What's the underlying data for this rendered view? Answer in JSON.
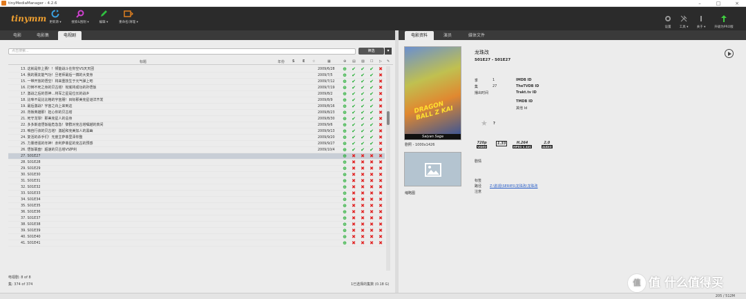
{
  "window": {
    "title": "tinyMediaManager - 4.2.6"
  },
  "toolbar": {
    "logo": "tinymm",
    "buttons": [
      {
        "label": "更新源 ▾",
        "icon": "refresh-icon"
      },
      {
        "label": "搜索&刮削 ▾",
        "icon": "search-icon"
      },
      {
        "label": "编辑 ▾",
        "icon": "edit-icon"
      },
      {
        "label": "重命名/清理 ▾",
        "icon": "rename-icon"
      }
    ],
    "right": [
      {
        "label": "设置",
        "icon": "gear-icon"
      },
      {
        "label": "工具 ▾",
        "icon": "tools-icon"
      },
      {
        "label": "关于 ▾",
        "icon": "info-icon"
      },
      {
        "label": "升级为PRO版",
        "icon": "upgrade-icon"
      }
    ]
  },
  "tabs": [
    "电影",
    "电影集",
    "电视剧"
  ],
  "right_tabs": [
    "电影资料",
    "演员",
    "媒体文件"
  ],
  "search": {
    "placeholder": "点击搜索...",
    "filter_label": "筛选"
  },
  "table": {
    "header_title": "标题",
    "header_year": "年份",
    "rows": [
      {
        "name": "13. 这就是你上赛！！倾能战斗在你空VS天天团",
        "date": "2009/6/28",
        "status": [
          "p",
          "o",
          "o",
          "o",
          "x",
          "x"
        ]
      },
      {
        "name": "14. 我的朋友能气功！旦老师最后一搏的大变身",
        "date": "2009/7/5",
        "status": [
          "p",
          "o",
          "o",
          "o",
          "x",
          "x"
        ]
      },
      {
        "name": "15. 一带开放的悟空！将来重技生于元气弹上吧",
        "date": "2009/7/12",
        "status": [
          "p",
          "o",
          "o",
          "o",
          "x",
          "x"
        ]
      },
      {
        "name": "16. 打倒不死之身的贝古塔！彻底将成功的孙悟饭",
        "date": "2009/7/19",
        "status": [
          "p",
          "o",
          "o",
          "o",
          "x",
          "x"
        ]
      },
      {
        "name": "17. 激战之后的冒神…将军之星是位长的战乡",
        "date": "2009/8/2",
        "status": [
          "p",
          "o",
          "o",
          "o",
          "x",
          "x"
        ]
      },
      {
        "name": "18. 比咪不是比比格的宇宙朋！目标那美克星谜洋齐发",
        "date": "2009/8/9",
        "status": [
          "p",
          "o",
          "o",
          "o",
          "x",
          "x"
        ]
      },
      {
        "name": "19. 最后激战？宇宙之舟上来到这",
        "date": "2009/8/16",
        "status": [
          "p",
          "o",
          "o",
          "o",
          "x",
          "x"
        ]
      },
      {
        "name": "20. 背叛英雄那！担心你的贝古塔",
        "date": "2009/8/23",
        "status": [
          "p",
          "o",
          "o",
          "o",
          "x",
          "x"
        ]
      },
      {
        "name": "21. 死守龙球！那美克星人的总身",
        "date": "2009/8/30",
        "status": [
          "p",
          "o",
          "o",
          "o",
          "x",
          "x"
        ]
      },
      {
        "name": "22. 多多斯迪悟饭临危急急！黎群对克古塔嘱越的真间",
        "date": "2009/9/6",
        "status": [
          "p",
          "o",
          "o",
          "o",
          "x",
          "x"
        ]
      },
      {
        "name": "23. 咱自行该的贝古塔！激起和克美加人的黑幽",
        "date": "2009/9/13",
        "status": [
          "p",
          "o",
          "o",
          "o",
          "x",
          "x"
        ]
      },
      {
        "name": "24. 复活的杀手们！无度主萨菲里泽你整",
        "date": "2009/9/20",
        "status": [
          "p",
          "o",
          "o",
          "o",
          "x",
          "x"
        ]
      },
      {
        "name": "25. 力量增强的年神！赤利萨菲星的克古的预感",
        "date": "2009/9/27",
        "status": [
          "p",
          "o",
          "o",
          "o",
          "x",
          "x"
        ]
      },
      {
        "name": "26. 悟饭联盘！超速的贝古塔VS萨利",
        "date": "2009/10/4",
        "status": [
          "p",
          "o",
          "o",
          "o",
          "x",
          "x"
        ]
      },
      {
        "name": "27. S01E27",
        "date": "",
        "status": [
          "p",
          "x",
          "x",
          "x",
          "x",
          "x"
        ],
        "selected": true
      },
      {
        "name": "28. S01E28",
        "date": "",
        "status": [
          "p",
          "x",
          "x",
          "x",
          "x",
          "x"
        ]
      },
      {
        "name": "29. S01E29",
        "date": "",
        "status": [
          "p",
          "x",
          "x",
          "x",
          "x",
          "x"
        ]
      },
      {
        "name": "30. S01E30",
        "date": "",
        "status": [
          "p",
          "x",
          "x",
          "x",
          "x",
          "x"
        ]
      },
      {
        "name": "31. S01E31",
        "date": "",
        "status": [
          "p",
          "x",
          "x",
          "x",
          "x",
          "x"
        ]
      },
      {
        "name": "32. S01E32",
        "date": "",
        "status": [
          "p",
          "x",
          "x",
          "x",
          "x",
          "x"
        ]
      },
      {
        "name": "33. S01E33",
        "date": "",
        "status": [
          "p",
          "x",
          "x",
          "x",
          "x",
          "x"
        ]
      },
      {
        "name": "34. S01E34",
        "date": "",
        "status": [
          "p",
          "x",
          "x",
          "x",
          "x",
          "x"
        ]
      },
      {
        "name": "35. S01E35",
        "date": "",
        "status": [
          "p",
          "x",
          "x",
          "x",
          "x",
          "x"
        ]
      },
      {
        "name": "36. S01E36",
        "date": "",
        "status": [
          "p",
          "x",
          "x",
          "x",
          "x",
          "x"
        ]
      },
      {
        "name": "37. S01E37",
        "date": "",
        "status": [
          "p",
          "x",
          "x",
          "x",
          "x",
          "x"
        ]
      },
      {
        "name": "38. S01E38",
        "date": "",
        "status": [
          "p",
          "x",
          "x",
          "x",
          "x",
          "x"
        ]
      },
      {
        "name": "39. S01E39",
        "date": "",
        "status": [
          "p",
          "x",
          "x",
          "x",
          "x",
          "x"
        ]
      },
      {
        "name": "40. S01E40",
        "date": "",
        "status": [
          "p",
          "x",
          "x",
          "x",
          "x",
          "x"
        ]
      },
      {
        "name": "41. S01E41",
        "date": "",
        "status": [
          "p",
          "x",
          "x",
          "x",
          "x",
          "x"
        ]
      }
    ]
  },
  "footer": {
    "series": "电视剧: 8 of 8",
    "episodes": "集: 374 of 374",
    "size": "1已选择的集数 (0.18 G)"
  },
  "detail": {
    "title": "龙珠改",
    "subtitle": "S01E27 - S01E27",
    "season_label": "季",
    "season_value": "1",
    "episode_label": "集",
    "episode_value": "27",
    "aired_label": "播出时间",
    "ids": [
      "IMDB ID",
      "TheTVDB ID",
      "Trakt.tv ID",
      "TMDB ID",
      "其他 Id"
    ],
    "rating": "?",
    "poster_caption": "Saiyan Saga",
    "poster_title": "DRAGON BALL Z KAI",
    "poster_size": "剧照 - 1000x1426",
    "fanart_caption": "缩略图",
    "plot_label": "剧情",
    "tags_label": "标签",
    "path_label": "路径",
    "note_label": "注意",
    "path_value": "Z:\\影视\\SERIES\\龙珠改\\龙珠改",
    "badges": [
      {
        "top": "720p",
        "bottom": "VIDEO"
      },
      {
        "top": "1.33",
        "bottom": ""
      },
      {
        "top": "H.264",
        "bottom": "MPEG-4 AVC"
      },
      {
        "top": "2.0",
        "bottom": "AUDIO"
      }
    ]
  },
  "statusbar": {
    "memory": "205 / 512M"
  },
  "watermark": "值 什么值得买"
}
